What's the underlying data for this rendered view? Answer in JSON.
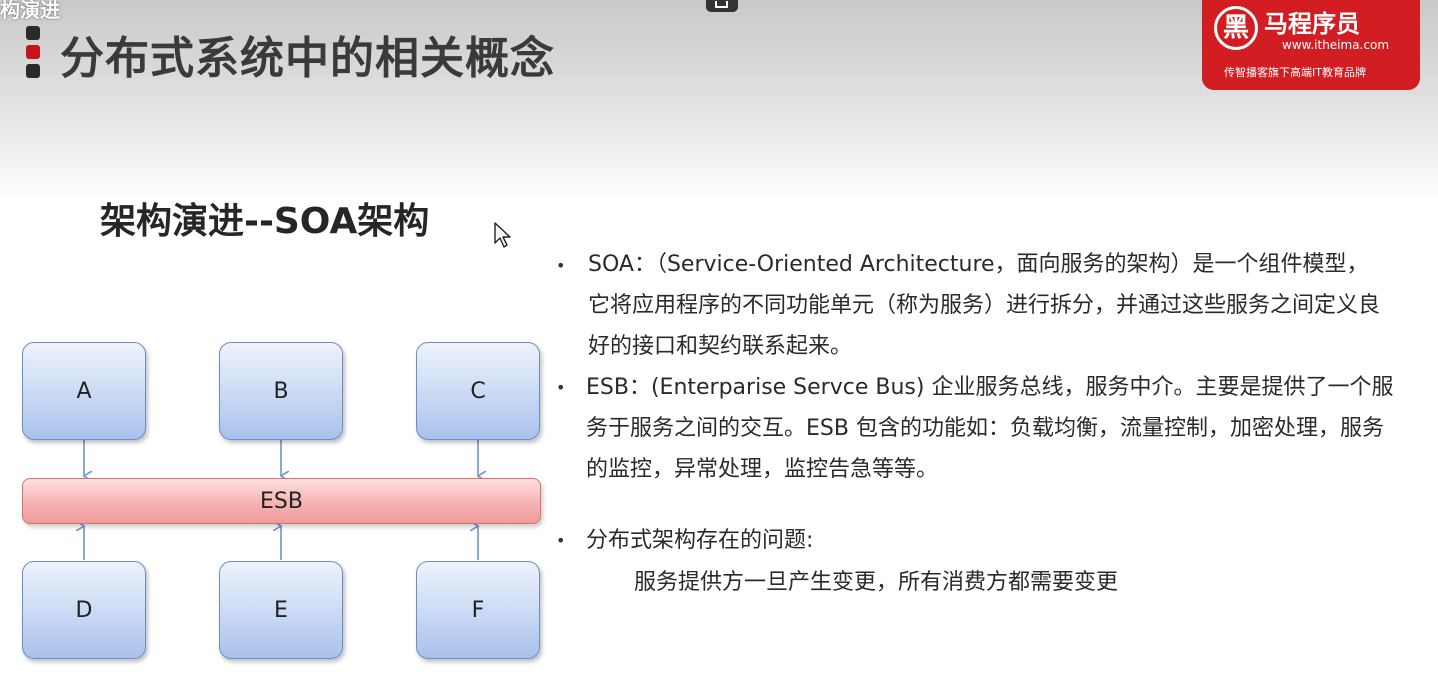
{
  "corner_label": "构演进",
  "page_title": "分布式系统中的相关概念",
  "logo": {
    "circle_glyph": "黑",
    "name": "马程序员",
    "url": "www.itheima.com",
    "slogan": "传智播客旗下高端IT教育品牌"
  },
  "section_title": "架构演进--SOA架构",
  "diagram": {
    "top_services": [
      "A",
      "B",
      "C"
    ],
    "bus_label": "ESB",
    "bottom_services": [
      "D",
      "E",
      "F"
    ]
  },
  "bullets": [
    {
      "lines": [
        "SOA：（Service-Oriented Architecture，面向服务的架构）是一个组件模型，",
        "它将应用程序的不同功能单元（称为服务）进行拆分，并通过这些服务之间定义良",
        "好的接口和契约联系起来。"
      ]
    },
    {
      "lines": [
        "ESB：(Enterparise Servce Bus) 企业服务总线，服务中介。主要是提供了一个服",
        "务于服务之间的交互。ESB 包含的功能如：负载均衡，流量控制，加密处理，服务",
        "的监控，异常处理，监控告急等等。"
      ]
    },
    {
      "title": "分布式架构存在的问题:",
      "detail": "服务提供方一旦产生变更，所有消费方都需要变更"
    }
  ],
  "colors": {
    "accent_red": "#d21d22",
    "box_border": "#6d8dc6",
    "bus_border": "#d67272",
    "arrow": "#6f93c9"
  },
  "icons": [
    "cursor-icon",
    "title-bullet-icon",
    "logo-icon",
    "window-widget-icon"
  ]
}
